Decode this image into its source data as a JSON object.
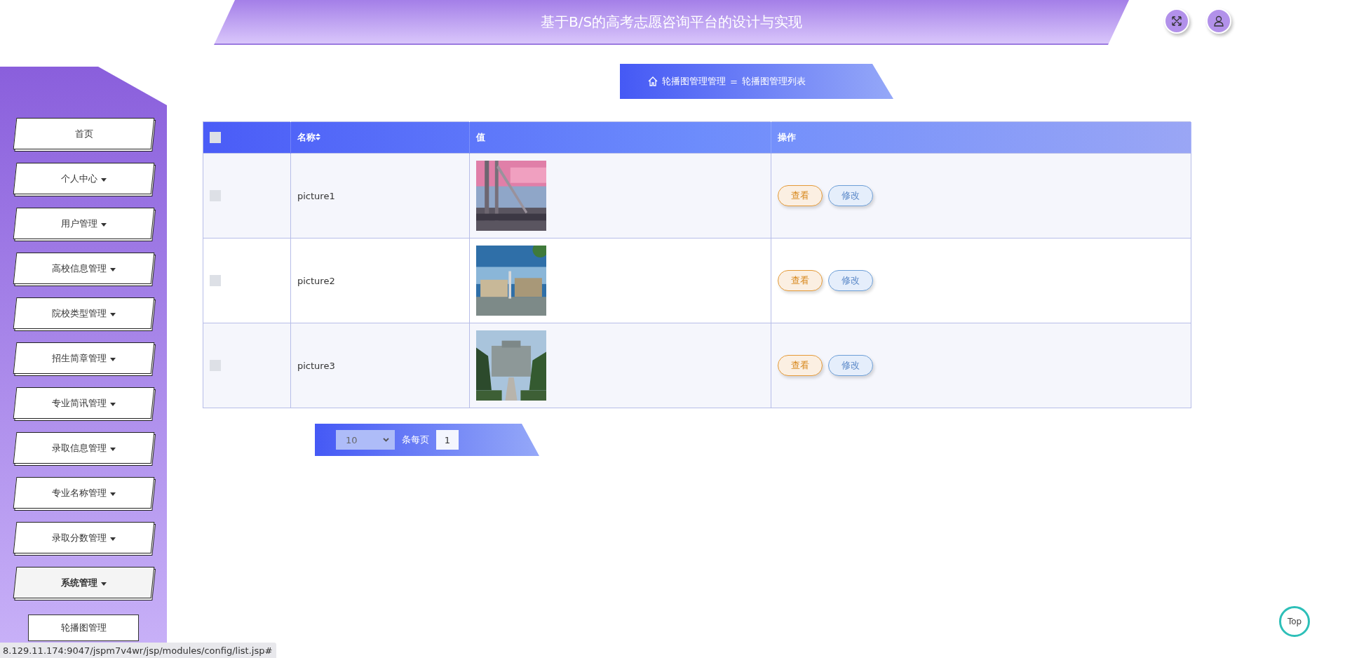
{
  "header": {
    "title": "基于B/S的高考志愿咨询平台的设计与实现"
  },
  "sidebar": {
    "items": [
      {
        "label": "首页",
        "kind": "link",
        "expanded": false
      },
      {
        "label": "个人中心",
        "kind": "dropdown",
        "expanded": false
      },
      {
        "label": "用户管理",
        "kind": "dropdown",
        "expanded": false
      },
      {
        "label": "高校信息管理",
        "kind": "dropdown",
        "expanded": false
      },
      {
        "label": "院校类型管理",
        "kind": "dropdown",
        "expanded": false
      },
      {
        "label": "招生简章管理",
        "kind": "dropdown",
        "expanded": false
      },
      {
        "label": "专业简讯管理",
        "kind": "dropdown",
        "expanded": false
      },
      {
        "label": "录取信息管理",
        "kind": "dropdown",
        "expanded": false
      },
      {
        "label": "专业名称管理",
        "kind": "dropdown",
        "expanded": false
      },
      {
        "label": "录取分数管理",
        "kind": "dropdown",
        "expanded": false
      },
      {
        "label": "系统管理",
        "kind": "dropdown",
        "expanded": true,
        "children": [
          {
            "label": "轮播图管理"
          }
        ]
      }
    ]
  },
  "breadcrumb": {
    "parent": "轮播图管理管理",
    "separator": "=",
    "current": "轮播图管理列表"
  },
  "table": {
    "select_all": {
      "checked": false
    },
    "columns": [
      "名称",
      "值",
      "操作"
    ],
    "rows": [
      {
        "checked": false,
        "name": "picture1",
        "value": {
          "kind": "picture"
        },
        "actions": [
          "查看",
          "修改"
        ]
      },
      {
        "checked": false,
        "name": "picture2",
        "value": {
          "kind": "picture"
        },
        "actions": [
          "查看",
          "修改"
        ]
      },
      {
        "checked": false,
        "name": "picture3",
        "value": {
          "kind": "picture"
        },
        "actions": [
          "查看",
          "修改"
        ]
      }
    ]
  },
  "pagination": {
    "page_size": "10",
    "page_size_label": "条每页",
    "page": "1"
  },
  "back_to_top": "Top",
  "status_bar": "8.129.11.174:9047/jspm7v4wr/jsp/modules/config/list.jsp#"
}
